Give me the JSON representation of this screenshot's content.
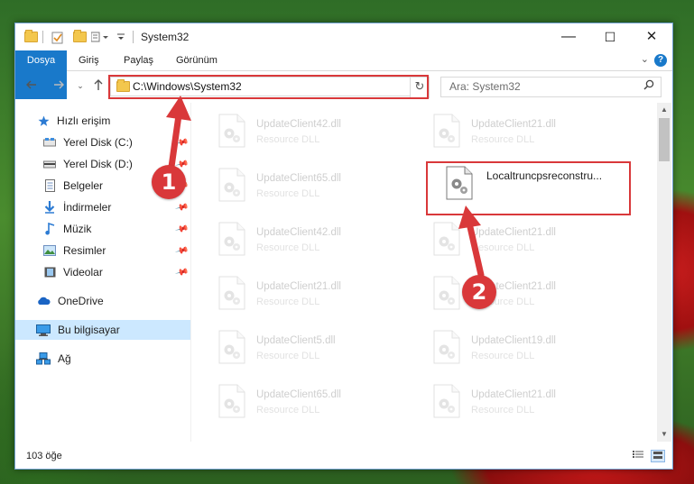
{
  "window": {
    "title": "System32",
    "controls": {
      "minimize": "—",
      "maximize": "☐",
      "close": "✕"
    }
  },
  "ribbon": {
    "tabs": [
      "Dosya",
      "Giriş",
      "Paylaş",
      "Görünüm"
    ],
    "help": "?"
  },
  "nav": {
    "address": "C:\\Windows\\System32",
    "search_placeholder": "Ara: System32"
  },
  "sidebar": {
    "items": [
      {
        "label": "Hızlı erişim",
        "icon": "star-icon"
      },
      {
        "label": "Yerel Disk (C:)",
        "icon": "drive-icon",
        "pinned": true
      },
      {
        "label": "Yerel Disk (D:)",
        "icon": "drive-icon",
        "pinned": true
      },
      {
        "label": "Belgeler",
        "icon": "document-icon",
        "pinned": true
      },
      {
        "label": "İndirmeler",
        "icon": "download-icon",
        "pinned": true
      },
      {
        "label": "Müzik",
        "icon": "music-icon",
        "pinned": true
      },
      {
        "label": "Resimler",
        "icon": "pictures-icon",
        "pinned": true
      },
      {
        "label": "Videolar",
        "icon": "videos-icon",
        "pinned": true
      },
      {
        "label": "OneDrive",
        "icon": "cloud-icon"
      },
      {
        "label": "Bu bilgisayar",
        "icon": "computer-icon",
        "selected": true
      },
      {
        "label": "Ağ",
        "icon": "network-icon"
      }
    ]
  },
  "files": [
    {
      "name": "UpdateClient42.dll",
      "type": "Resource DLL"
    },
    {
      "name": "UpdateClient21.dll",
      "type": "Resource DLL"
    },
    {
      "name": "UpdateClient65.dll",
      "type": "Resource DLL"
    },
    {
      "name": "Localtruncpsreconstru...",
      "type": "",
      "highlighted": true
    },
    {
      "name": "UpdateClient42.dll",
      "type": "Resource DLL"
    },
    {
      "name": "UpdateClient21.dll",
      "type": "Resource DLL"
    },
    {
      "name": "UpdateClient21.dll",
      "type": "Resource DLL"
    },
    {
      "name": "UpdateClient21.dll",
      "type": "Resource DLL"
    },
    {
      "name": "UpdateClient5.dll",
      "type": "Resource DLL"
    },
    {
      "name": "UpdateClient19.dll",
      "type": "Resource DLL"
    },
    {
      "name": "UpdateClient65.dll",
      "type": "Resource DLL"
    },
    {
      "name": "UpdateClient21.dll",
      "type": "Resource DLL"
    }
  ],
  "status": {
    "count": "103 öğe"
  },
  "callouts": [
    "1",
    "2"
  ],
  "colors": {
    "accent": "#1979ca",
    "callout": "#d9383a",
    "selection": "#cce8ff"
  }
}
